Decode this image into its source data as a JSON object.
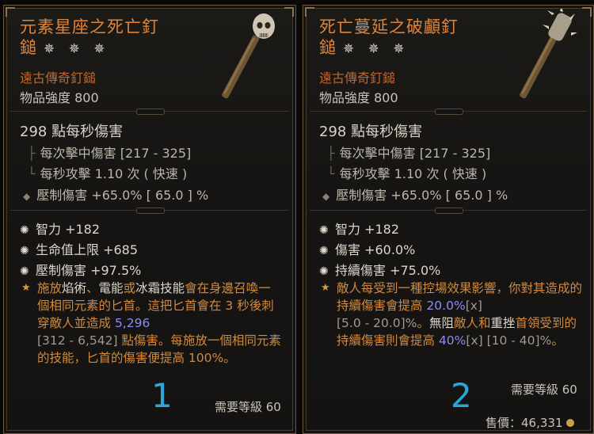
{
  "cards": [
    {
      "number": "1",
      "title_line1": "元素星座之死亡釘",
      "title_line2": "鎚",
      "stars": "✵ ✵ ✵",
      "item_type": "遠古傳奇釘鎚",
      "item_power": "物品強度 800",
      "dps": "298 點每秒傷害",
      "stats": [
        "每次擊中傷害 [217 - 325]",
        "每秒攻擊 1.10 次 ( 快速 )",
        "壓制傷害 +65.0%  [ 65.0 ] %"
      ],
      "affixes": [
        "智力 +182",
        "生命值上限 +685",
        "壓制傷害 +97.5%"
      ],
      "aspect": {
        "p1": "施放",
        "k1": "焰術",
        "p2": "、",
        "k2": "電能",
        "p3": "或",
        "k3": "冰霜",
        "k4": "技能",
        "p4": "會在身邊召喚一個相同元素的匕首。這把匕首會在 3 秒後刺穿敵人並造成 ",
        "v1": "5,296",
        "r1": "[312 - 6,542]",
        "p5": " 點傷害。每施放一個相同元素的技能，匕首的傷害便提高 100%。"
      },
      "requirement": "需要等級 60"
    },
    {
      "number": "2",
      "title_line1": "死亡蔓延之破顱釘",
      "title_line2": "鎚",
      "stars": "✵ ✵ ✵",
      "item_type": "遠古傳奇釘鎚",
      "item_power": "物品強度 800",
      "dps": "298 點每秒傷害",
      "stats": [
        "每次擊中傷害 [217 - 325]",
        "每秒攻擊 1.10 次 ( 快速 )",
        "壓制傷害 +65.0%  [ 65.0 ] %"
      ],
      "affixes": [
        "智力 +182",
        "傷害 +60.0%",
        "持續傷害 +75.0%"
      ],
      "aspect": {
        "p1": "敵人每受到一種控場效果影響，你對其造成的持續傷害會提高 ",
        "v1": "20.0%",
        "r1": "[x]",
        "r2": "[5.0 - 20.0]%",
        "p2": "。",
        "k1": "無阻",
        "p3": "敵人和",
        "k2": "重挫",
        "p4": "首領受到的持續傷害則會提高 ",
        "v2": "40%",
        "r3": "[x] [10 - 40]%",
        "p5": "。"
      },
      "requirement": "需要等級 60",
      "sell": "售價：46,331"
    }
  ]
}
